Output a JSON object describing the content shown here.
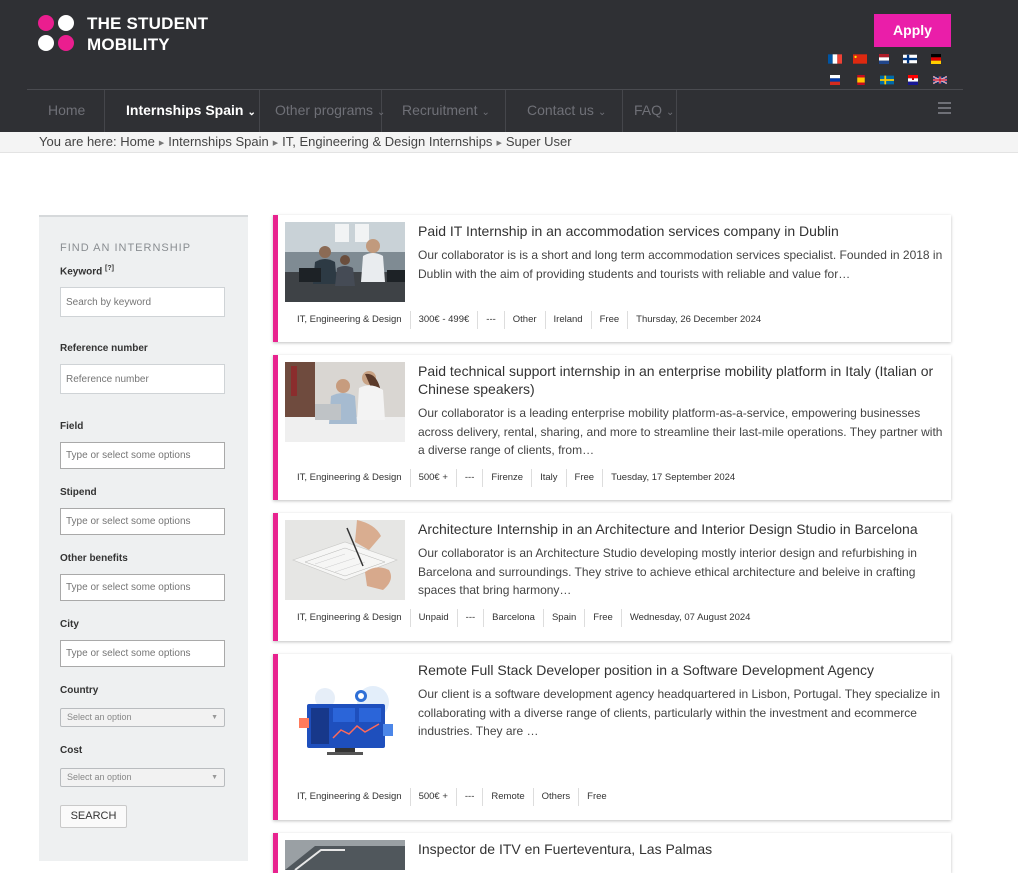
{
  "header": {
    "logo_line1": "THE STUDENT",
    "logo_line2": "MOBILITY",
    "apply_label": "Apply",
    "accent_color": "#ea1ea9",
    "flags": [
      "french-flag",
      "chinese-flag",
      "dutch-flag",
      "finnish-flag",
      "german-flag",
      "russian-flag",
      "spanish-flag",
      "swedish-flag",
      "croatian-flag",
      "uk-flag"
    ]
  },
  "nav": {
    "items": [
      {
        "label": "Home"
      },
      {
        "label": "Internships Spain",
        "chevron": "⌄"
      },
      {
        "label": "Other programs",
        "chevron": "⌄"
      },
      {
        "label": "Recruitment",
        "chevron": "⌄"
      },
      {
        "label": "Contact us",
        "chevron": "⌄"
      },
      {
        "label": "FAQ",
        "chevron": "⌄"
      }
    ]
  },
  "breadcrumb": {
    "prefix": "You are here:",
    "items": [
      "Home",
      "Internships Spain",
      "IT, Engineering & Design Internships",
      "Super User"
    ]
  },
  "sidebar": {
    "title": "FIND AN INTERNSHIP",
    "keyword_label": "Keyword",
    "keyword_hint": "[?]",
    "keyword_placeholder": "Search by keyword",
    "reference_label": "Reference number",
    "reference_placeholder": "Reference number",
    "field_label": "Field",
    "stipend_label": "Stipend",
    "benefits_label": "Other benefits",
    "city_label": "City",
    "multi_placeholder": "Type or select some options",
    "country_label": "Country",
    "country_value": "Select an option",
    "cost_label": "Cost",
    "cost_value": "Select an option",
    "search_label": "SEARCH"
  },
  "listings": [
    {
      "title": "Paid IT Internship in an accommodation services company in Dublin",
      "description": "Our collaborator is is a short and long term accommodation services specialist. Founded in 2018 in Dublin with the aim of providing students and tourists with reliable and value for…",
      "meta": [
        "IT, Engineering & Design",
        "300€ - 499€",
        "---",
        "Other",
        "Ireland",
        "Free",
        "Thursday, 26 December 2024"
      ]
    },
    {
      "title": "Paid technical support internship in an enterprise mobility platform in Italy (Italian or Chinese speakers)",
      "description": "Our collaborator is a leading enterprise mobility platform-as-a-service, empowering businesses across delivery, rental, sharing, and more to streamline their last-mile operations. They partner with a diverse range of clients, from…",
      "meta": [
        "IT, Engineering & Design",
        "500€ +",
        "---",
        "Firenze",
        "Italy",
        "Free",
        "Tuesday, 17 September 2024"
      ]
    },
    {
      "title": "Architecture Internship in an Architecture and Interior Design Studio in Barcelona",
      "description": "Our collaborator is an Architecture Studio developing mostly interior design and refurbishing in Barcelona and surroundings. They strive to achieve ethical architecture and beleive in crafting spaces that bring harmony…",
      "meta": [
        "IT, Engineering & Design",
        "Unpaid",
        "---",
        "Barcelona",
        "Spain",
        "Free",
        "Wednesday, 07 August 2024"
      ]
    },
    {
      "title": "Remote Full Stack Developer position in a Software Development Agency",
      "description": "Our client is a software development agency headquartered in Lisbon, Portugal. They specialize in collaborating with a diverse range of clients, particularly within the investment and ecommerce industries. They are …",
      "meta": [
        "IT, Engineering & Design",
        "500€ +",
        "---",
        "Remote",
        "Others",
        "Free"
      ]
    },
    {
      "title": "Inspector de ITV en Fuerteventura, Las Palmas",
      "description": "",
      "meta": []
    }
  ]
}
